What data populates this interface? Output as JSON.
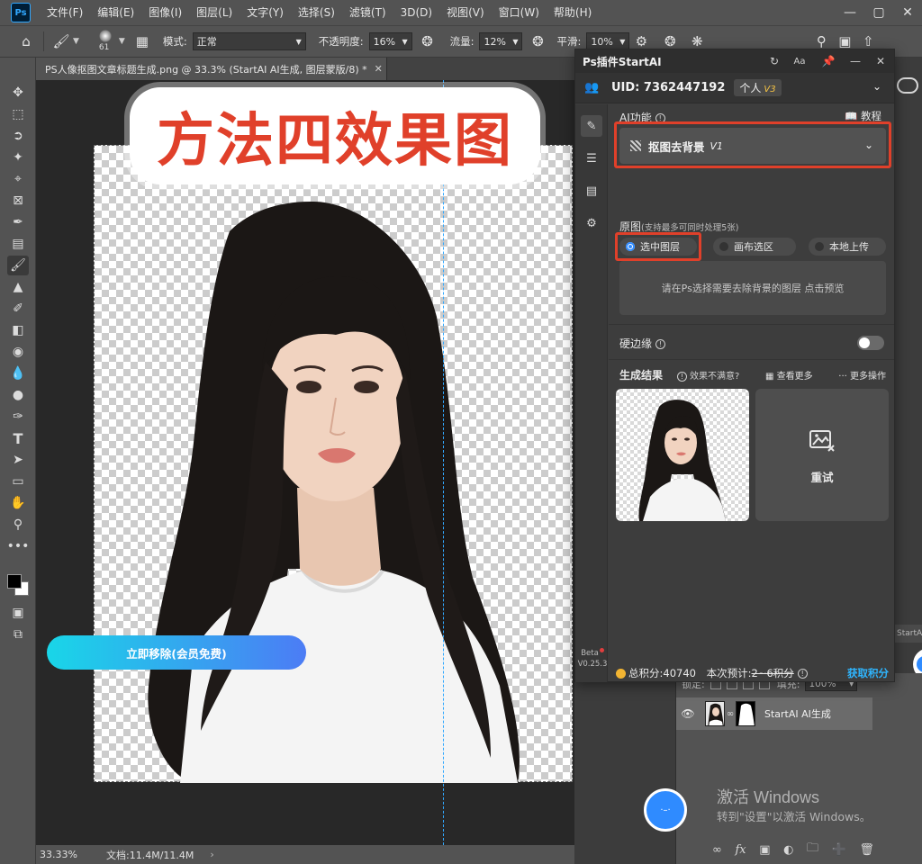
{
  "app": {
    "logo": "Ps",
    "menu": [
      "文件(F)",
      "编辑(E)",
      "图像(I)",
      "图层(L)",
      "文字(Y)",
      "选择(S)",
      "滤镜(T)",
      "3D(D)",
      "视图(V)",
      "窗口(W)",
      "帮助(H)"
    ],
    "window_controls": [
      "minimize-icon",
      "maximize-icon",
      "close-icon"
    ]
  },
  "options_bar": {
    "brush_size": "61",
    "mode_label": "模式:",
    "mode_value": "正常",
    "opacity_label": "不透明度:",
    "opacity_value": "16%",
    "flow_label": "流量:",
    "flow_value": "12%",
    "smooth_label": "平滑:",
    "smooth_value": "10%"
  },
  "document": {
    "tab_title": "PS人像抠图文章标题生成.png @ 33.3% (StartAI AI生成, 图层蒙版/8) *",
    "overlay_title": "方法四效果图"
  },
  "status_bar": {
    "zoom": "33.33%",
    "doc_info": "文档:11.4M/11.4M",
    "arrow": "›"
  },
  "plugin": {
    "title": "Ps插件StartAI",
    "uid": "UID: 7362447192",
    "plan": "个人",
    "plan_version": "V3",
    "ai_label": "AI功能",
    "tutorial": "教程",
    "function": "抠图去背景",
    "function_version": "V1",
    "source_label": "原图",
    "source_hint": "(支持最多可同时处理5张)",
    "source_options": [
      "选中图层",
      "画布选区",
      "本地上传"
    ],
    "hint_text": "请在Ps选择需要去除背景的图层 点击预览",
    "hard_edge_label": "硬边缘",
    "hard_edge_on": false,
    "results_label": "生成结果",
    "unsatisfied": "效果不满意?",
    "view_more": "查看更多",
    "more_ops": "更多操作",
    "retry": "重试",
    "credits": "总积分:40740",
    "estimate_prefix": "本次预计:",
    "estimate_value": "2~6积分",
    "get_credits": "获取积分",
    "main_button": "立即移除(会员免费)",
    "beta_label": "Beta",
    "version": "V0.25.3"
  },
  "layers": {
    "lock_label": "锁定:",
    "fill_label": "填充:",
    "fill_value": "100%",
    "layer_name": "StartAI AI生成",
    "side_peek": "StartA"
  },
  "watermark": {
    "title": "激活 Windows",
    "subtitle": "转到\"设置\"以激活 Windows。"
  },
  "colors": {
    "accent": "#31a8ff",
    "highlight_frame": "#e0402a",
    "credit_link": "#2fb6ff",
    "button_from": "#19d6e8",
    "button_to": "#4c7cf5"
  }
}
